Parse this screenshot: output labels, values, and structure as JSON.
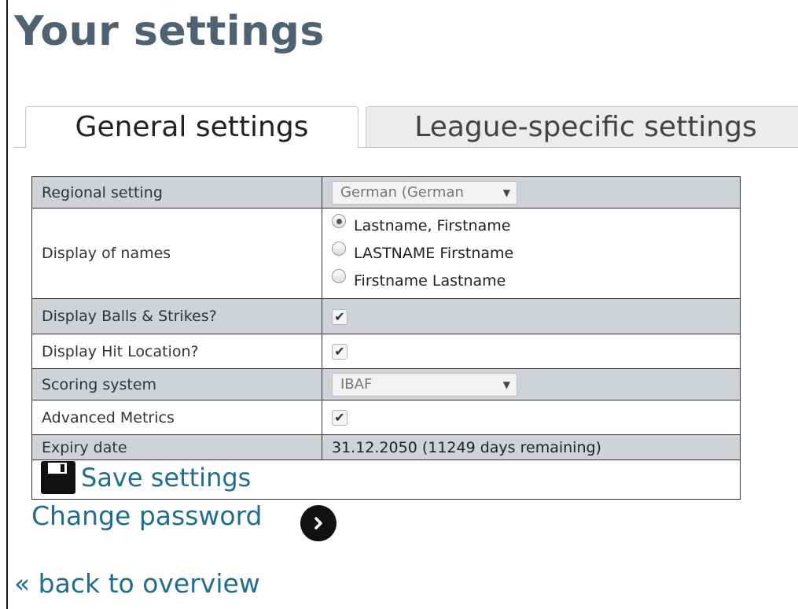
{
  "page": {
    "title": "Your settings"
  },
  "tabs": [
    {
      "label": "General settings",
      "active": true
    },
    {
      "label": "League-specific settings",
      "active": false
    }
  ],
  "settings": {
    "regional": {
      "label": "Regional setting",
      "value": "German (German"
    },
    "names": {
      "label": "Display of names",
      "options": [
        "Lastname, Firstname",
        "LASTNAME Firstname",
        "Firstname Lastname"
      ],
      "selected_index": 0
    },
    "balls_strikes": {
      "label": "Display Balls & Strikes?",
      "checked": true
    },
    "hit_location": {
      "label": "Display Hit Location?",
      "checked": true
    },
    "scoring": {
      "label": "Scoring system",
      "value": "IBAF"
    },
    "advanced": {
      "label": "Advanced Metrics",
      "checked": true
    },
    "expiry": {
      "label": "Expiry date",
      "value": "31.12.2050 (11249 days remaining)"
    }
  },
  "actions": {
    "save_label": "Save settings",
    "change_password_label": "Change password",
    "back_label": "« back to overview"
  },
  "icons": {
    "save": "floppy-disk-icon",
    "go": "chevron-right-circle-icon",
    "dropdown": "dropdown-arrow-icon",
    "check": "checkmark-icon"
  },
  "colors": {
    "title": "#4f6271",
    "link": "#1f6f8b",
    "row_gray": "#cfd2d6"
  }
}
